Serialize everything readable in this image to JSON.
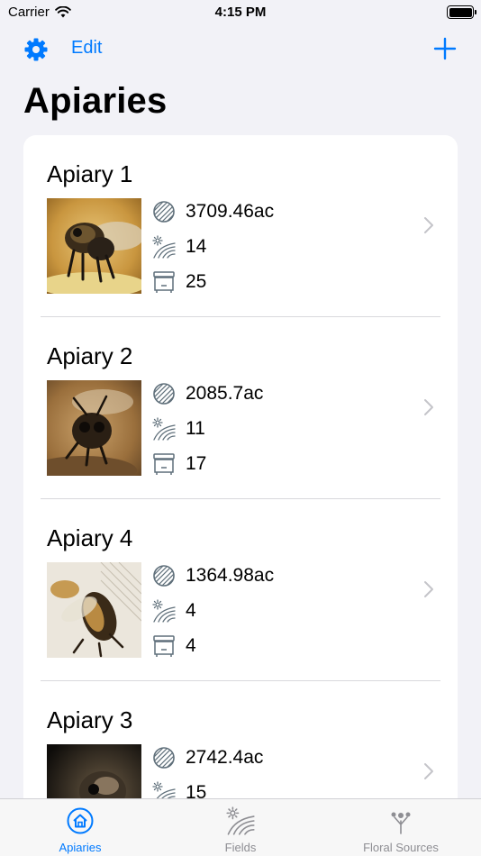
{
  "status_bar": {
    "carrier": "Carrier",
    "time": "4:15 PM"
  },
  "nav": {
    "edit_label": "Edit",
    "settings_icon": "gear-icon",
    "add_icon": "plus-icon"
  },
  "page_title": "Apiaries",
  "apiaries": [
    {
      "name": "Apiary 1",
      "area": "3709.46ac",
      "fields": "14",
      "hives": "25"
    },
    {
      "name": "Apiary 2",
      "area": "2085.7ac",
      "fields": "11",
      "hives": "17"
    },
    {
      "name": "Apiary 4",
      "area": "1364.98ac",
      "fields": "4",
      "hives": "4"
    },
    {
      "name": "Apiary 3",
      "area": "2742.4ac",
      "fields": "15",
      "hives": ""
    }
  ],
  "tabs": [
    {
      "label": "Apiaries",
      "icon": "house-circle-icon",
      "active": true
    },
    {
      "label": "Fields",
      "icon": "field-icon",
      "active": false
    },
    {
      "label": "Floral Sources",
      "icon": "flower-icon",
      "active": false
    }
  ],
  "colors": {
    "accent": "#007aff",
    "background": "#f2f2f7",
    "icon_gray": "#5f6f7a"
  }
}
